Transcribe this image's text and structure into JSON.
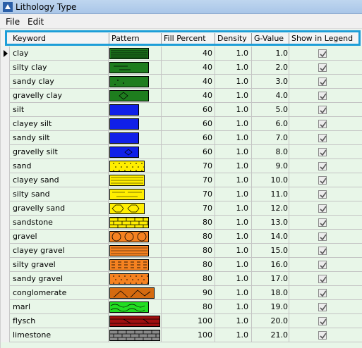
{
  "window": {
    "title": "Lithology Type"
  },
  "menu": {
    "file": "File",
    "edit": "Edit"
  },
  "columns": {
    "keyword": "Keyword",
    "pattern": "Pattern",
    "fill_percent": "Fill Percent",
    "density": "Density",
    "g_value": "G-Value",
    "show_in_legend": "Show in Legend"
  },
  "rows": [
    {
      "keyword": "clay",
      "fill": "40",
      "density": "1.0",
      "gvalue": "1.0",
      "show": true,
      "pattern": "clay",
      "pcolor": "#1e7d1e"
    },
    {
      "keyword": "silty clay",
      "fill": "40",
      "density": "1.0",
      "gvalue": "2.0",
      "show": true,
      "pattern": "silty-clay",
      "pcolor": "#1e7d1e"
    },
    {
      "keyword": "sandy clay",
      "fill": "40",
      "density": "1.0",
      "gvalue": "3.0",
      "show": true,
      "pattern": "sandy-clay",
      "pcolor": "#1e7d1e"
    },
    {
      "keyword": "gravelly clay",
      "fill": "40",
      "density": "1.0",
      "gvalue": "4.0",
      "show": true,
      "pattern": "gravelly-clay",
      "pcolor": "#1e7d1e"
    },
    {
      "keyword": "silt",
      "fill": "60",
      "density": "1.0",
      "gvalue": "5.0",
      "show": true,
      "pattern": "silt",
      "pcolor": "#1020e8"
    },
    {
      "keyword": "clayey silt",
      "fill": "60",
      "density": "1.0",
      "gvalue": "6.0",
      "show": true,
      "pattern": "clayey-silt",
      "pcolor": "#1020e8"
    },
    {
      "keyword": "sandy silt",
      "fill": "60",
      "density": "1.0",
      "gvalue": "7.0",
      "show": true,
      "pattern": "sandy-silt",
      "pcolor": "#1020e8"
    },
    {
      "keyword": "gravelly silt",
      "fill": "60",
      "density": "1.0",
      "gvalue": "8.0",
      "show": true,
      "pattern": "gravelly-silt",
      "pcolor": "#1020e8"
    },
    {
      "keyword": "sand",
      "fill": "70",
      "density": "1.0",
      "gvalue": "9.0",
      "show": true,
      "pattern": "sand",
      "pcolor": "#ffee00"
    },
    {
      "keyword": "clayey sand",
      "fill": "70",
      "density": "1.0",
      "gvalue": "10.0",
      "show": true,
      "pattern": "clayey-sand",
      "pcolor": "#ffee00"
    },
    {
      "keyword": "silty sand",
      "fill": "70",
      "density": "1.0",
      "gvalue": "11.0",
      "show": true,
      "pattern": "silty-sand",
      "pcolor": "#ffee00"
    },
    {
      "keyword": "gravelly sand",
      "fill": "70",
      "density": "1.0",
      "gvalue": "12.0",
      "show": true,
      "pattern": "gravelly-sand",
      "pcolor": "#ffee00"
    },
    {
      "keyword": "sandstone",
      "fill": "80",
      "density": "1.0",
      "gvalue": "13.0",
      "show": true,
      "pattern": "sandstone",
      "pcolor": "#ffee00"
    },
    {
      "keyword": "gravel",
      "fill": "80",
      "density": "1.0",
      "gvalue": "14.0",
      "show": true,
      "pattern": "gravel",
      "pcolor": "#f58220"
    },
    {
      "keyword": "clayey gravel",
      "fill": "80",
      "density": "1.0",
      "gvalue": "15.0",
      "show": true,
      "pattern": "clayey-gravel",
      "pcolor": "#f58220"
    },
    {
      "keyword": "silty gravel",
      "fill": "80",
      "density": "1.0",
      "gvalue": "16.0",
      "show": true,
      "pattern": "silty-gravel",
      "pcolor": "#f58220"
    },
    {
      "keyword": "sandy gravel",
      "fill": "80",
      "density": "1.0",
      "gvalue": "17.0",
      "show": true,
      "pattern": "sandy-gravel",
      "pcolor": "#f58220"
    },
    {
      "keyword": "conglomerate",
      "fill": "90",
      "density": "1.0",
      "gvalue": "18.0",
      "show": true,
      "pattern": "conglomerate",
      "pcolor": "#d46a10"
    },
    {
      "keyword": "marl",
      "fill": "80",
      "density": "1.0",
      "gvalue": "19.0",
      "show": true,
      "pattern": "marl",
      "pcolor": "#22dd22"
    },
    {
      "keyword": "flysch",
      "fill": "100",
      "density": "1.0",
      "gvalue": "20.0",
      "show": true,
      "pattern": "flysch",
      "pcolor": "#a01010"
    },
    {
      "keyword": "limestone",
      "fill": "100",
      "density": "1.0",
      "gvalue": "21.0",
      "show": true,
      "pattern": "limestone",
      "pcolor": "#8a8a8a"
    }
  ]
}
